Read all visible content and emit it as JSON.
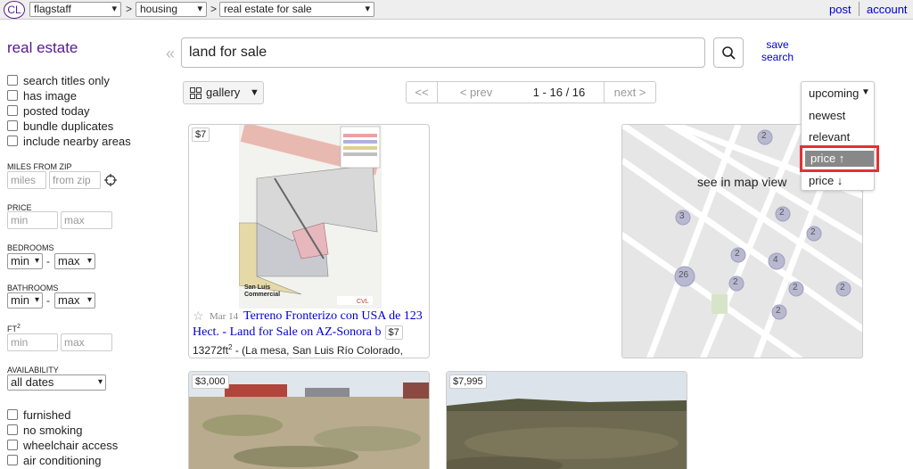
{
  "topbar": {
    "logo": "CL",
    "crumbs": [
      "flagstaff",
      "housing",
      "real estate for sale"
    ],
    "separator": ">",
    "post_label": "post",
    "account_label": "account"
  },
  "sidebar": {
    "title": "real estate",
    "checkboxes_top": [
      "search titles only",
      "has image",
      "posted today",
      "bundle duplicates",
      "include nearby areas"
    ],
    "miles_label": "MILES FROM ZIP",
    "miles_placeholder": "miles",
    "zip_placeholder": "from zip",
    "price_label": "PRICE",
    "min_placeholder": "min",
    "max_placeholder": "max",
    "bedrooms_label": "BEDROOMS",
    "bathrooms_label": "BATHROOMS",
    "select_min": "min",
    "select_max": "max",
    "dash": "-",
    "ft_label": "FT",
    "ft_sup": "2",
    "availability_label": "AVAILABILITY",
    "availability_value": "all dates",
    "checkboxes_bottom": [
      "furnished",
      "no smoking",
      "wheelchair access",
      "air conditioning"
    ]
  },
  "search": {
    "query": "land for sale",
    "save_line1": "save",
    "save_line2": "search"
  },
  "toolbar": {
    "view_label": "gallery",
    "first": "<<",
    "prev": "< prev",
    "range": "1 - 16 / 16",
    "next": "next >"
  },
  "sort": {
    "current": "upcoming",
    "options": [
      "newest",
      "relevant",
      "price ↑",
      "price ↓"
    ],
    "selected": "price ↑"
  },
  "results": [
    {
      "price": "$7",
      "date": "Mar 14",
      "title_line1": "Terreno Fronterizo con USA de 123",
      "title_line2": "Hect. - Land for Sale on AZ-Sonora b",
      "inline_price": "$7",
      "meta": "13272ft",
      "meta_sup": "2",
      "meta_rest": " - (La mesa, San Luis Río Colorado,"
    },
    {
      "price": "$3,000"
    },
    {
      "price": "$7,995"
    }
  ],
  "plan": {
    "caption1": "San Luis",
    "caption2": "Commercial"
  },
  "map": {
    "label": "see in map view",
    "clusters": [
      "3",
      "2",
      "2",
      "4",
      "26",
      "2",
      "2",
      "2",
      "2",
      "2",
      "2"
    ]
  },
  "colors": {
    "link": "#0000cc",
    "brand": "#551a8b",
    "highlight": "#e53030"
  }
}
